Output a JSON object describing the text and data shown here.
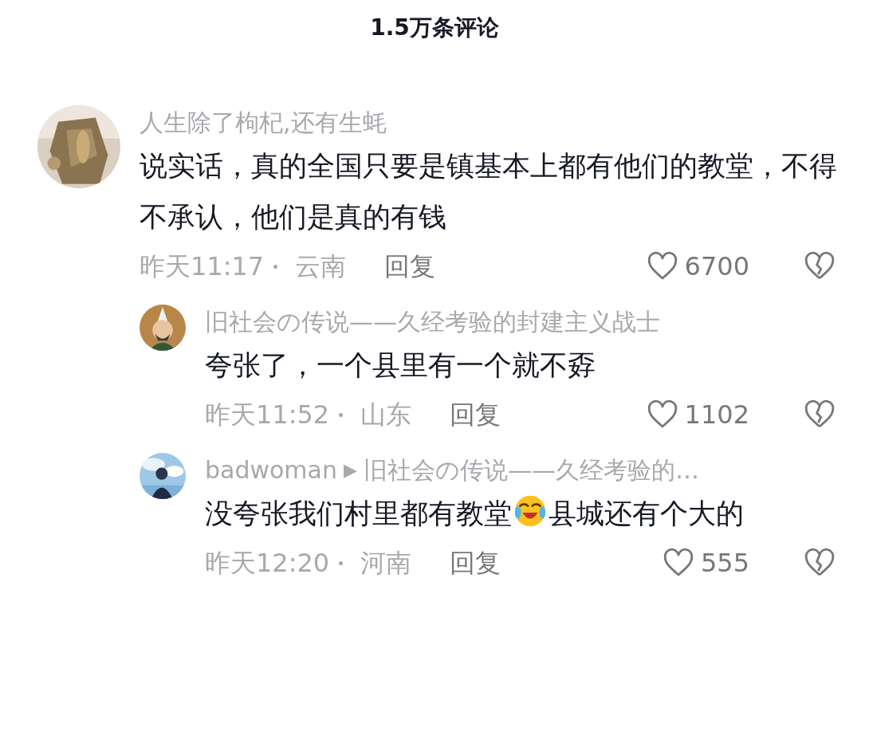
{
  "header": {
    "title": "1.5万条评论"
  },
  "comments": [
    {
      "user": "人生除了枸杞,还有生蚝",
      "avatar": {
        "kind": "picture"
      },
      "content": [
        {
          "kind": "text",
          "text": "说实话，真的全国只要是镇基本上都有他们的教堂，不得不承认，他们是真的有钱"
        }
      ],
      "time": "昨天11:17",
      "location": "云南",
      "reply_label": "回复",
      "likes": "6700",
      "liked": false,
      "children": [
        {
          "user": "旧社会の传说——久经考验的封建主义战士",
          "avatar": {
            "kind": "picture"
          },
          "content": [
            {
              "kind": "text",
              "text": "夸张了，一个县里有一个就不孬"
            }
          ],
          "time": "昨天11:52",
          "location": "山东",
          "reply_label": "回复",
          "likes": "1102",
          "liked": false
        },
        {
          "user": "badwoman",
          "reply_arrow": "▶",
          "reply_to": "旧社会の传说——久经考验的…",
          "avatar": {
            "kind": "picture"
          },
          "content": [
            {
              "kind": "text",
              "text": "没夸张我们村里都有教堂"
            },
            {
              "kind": "emoji"
            },
            {
              "kind": "text",
              "text": "县城还有个大的"
            }
          ],
          "time": "昨天12:20",
          "location": "河南",
          "reply_label": "回复",
          "likes": "555",
          "liked": false
        }
      ]
    }
  ]
}
